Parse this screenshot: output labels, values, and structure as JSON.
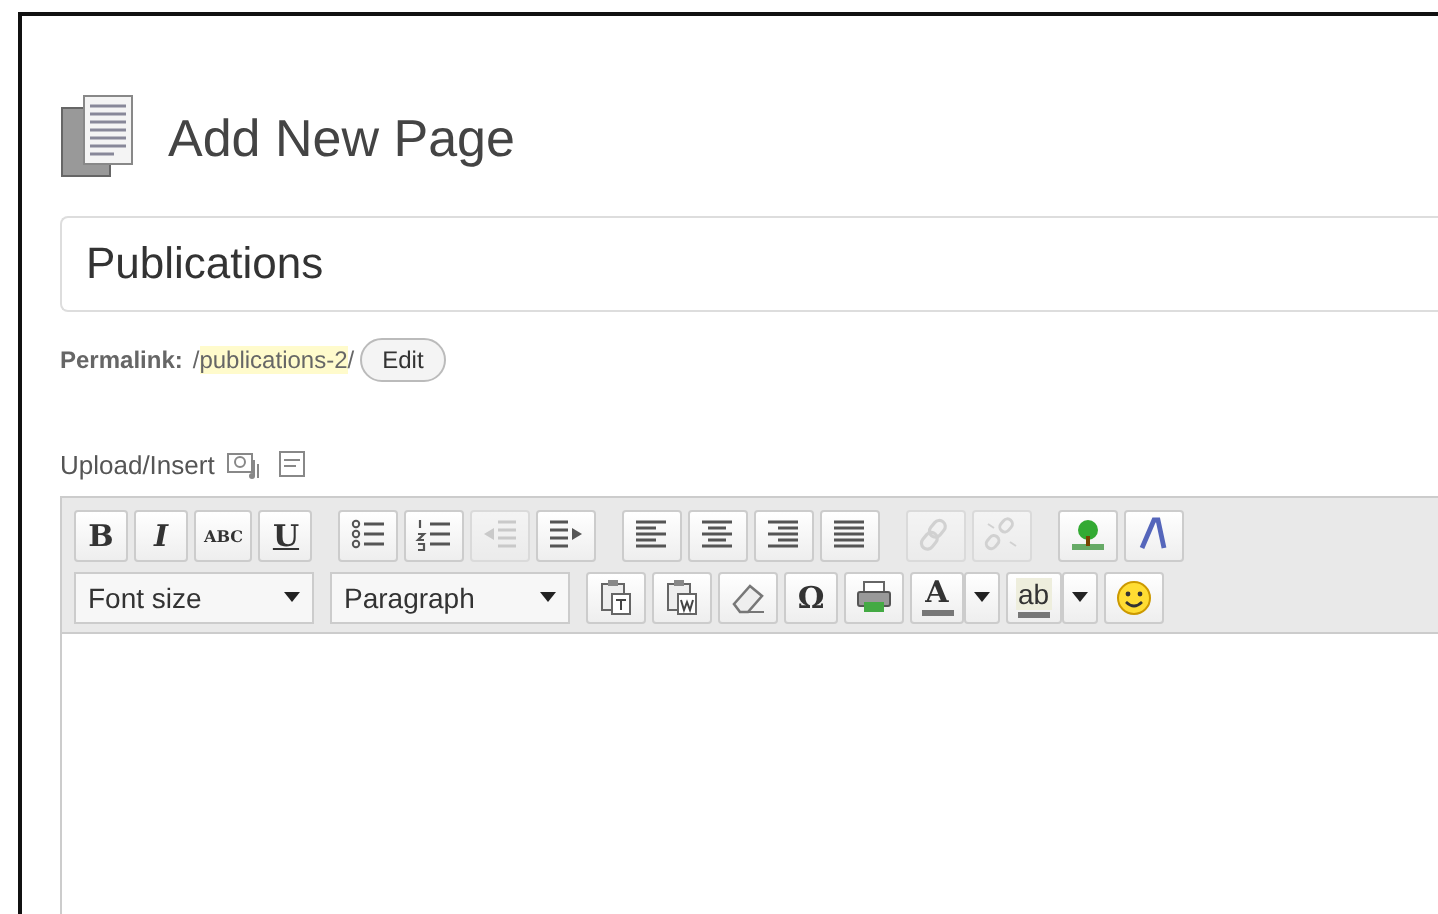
{
  "header": {
    "title": "Add New Page"
  },
  "title_field": {
    "value": "Publications"
  },
  "permalink": {
    "label": "Permalink:",
    "prefix": "/",
    "slug": "publications-2",
    "suffix": "/",
    "edit_button": "Edit"
  },
  "upload_insert": {
    "label": "Upload/Insert"
  },
  "toolbar_row_1": [
    {
      "kind": "bold",
      "label": "B",
      "disabled": false
    },
    {
      "kind": "italic",
      "label": "I",
      "disabled": false
    },
    {
      "kind": "strike",
      "label": "ABC",
      "disabled": false
    },
    {
      "kind": "underline",
      "label": "U",
      "disabled": false
    },
    {
      "kind": "bullets",
      "disabled": false
    },
    {
      "kind": "numbers",
      "disabled": false
    },
    {
      "kind": "outdent",
      "disabled": true
    },
    {
      "kind": "indent",
      "disabled": false
    },
    {
      "kind": "alignleft",
      "disabled": false
    },
    {
      "kind": "aligncenter",
      "disabled": false
    },
    {
      "kind": "alignright",
      "disabled": false
    },
    {
      "kind": "justify",
      "disabled": false
    },
    {
      "kind": "link",
      "disabled": true
    },
    {
      "kind": "unlink",
      "disabled": true
    },
    {
      "kind": "image",
      "disabled": false
    },
    {
      "kind": "styles",
      "disabled": false
    }
  ],
  "toolbar_row_2": [
    {
      "kind": "select",
      "label": "Font size"
    },
    {
      "kind": "select",
      "label": "Paragraph"
    },
    {
      "kind": "pastetext"
    },
    {
      "kind": "pasteword"
    },
    {
      "kind": "eraser"
    },
    {
      "kind": "symbol",
      "label": "Ω"
    },
    {
      "kind": "print"
    },
    {
      "kind": "textcolor",
      "label": "A"
    },
    {
      "kind": "highlight",
      "label": "ab"
    },
    {
      "kind": "smiley"
    }
  ]
}
